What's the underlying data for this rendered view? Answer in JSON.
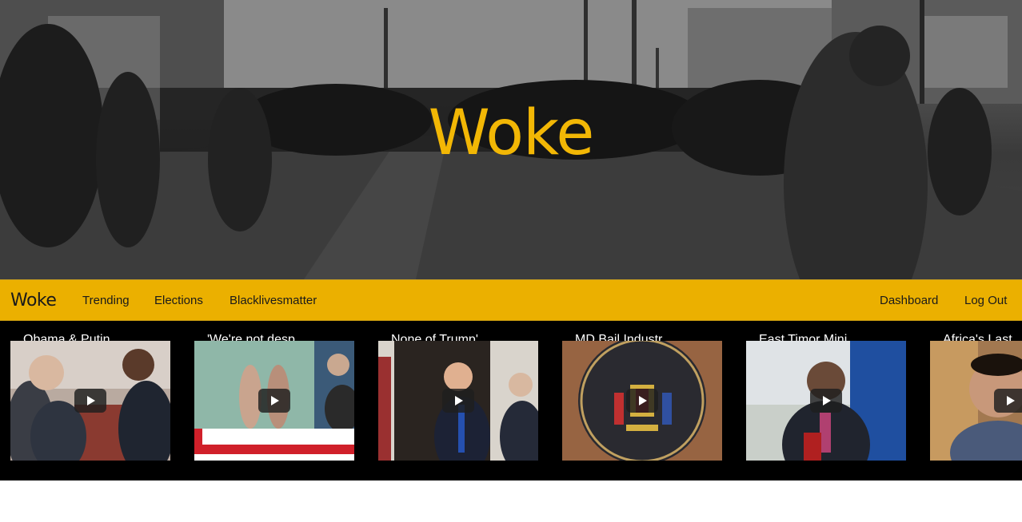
{
  "hero": {
    "title": "Woke",
    "background_icon": "street-protest-photo"
  },
  "navbar": {
    "brand": "Woke",
    "left_links": [
      "Trending",
      "Elections",
      "Blacklivesmatter"
    ],
    "right_links": [
      "Dashboard",
      "Log Out"
    ]
  },
  "videos": [
    {
      "title": "Obama & Putin ...",
      "thumb_icon": "leaders-meeting-thumbnail"
    },
    {
      "title": "'We're not desp...",
      "thumb_icon": "news-broadcast-thumbnail"
    },
    {
      "title": "None of Trump'...",
      "thumb_icon": "press-doorway-thumbnail"
    },
    {
      "title": "MD Bail Industr...",
      "thumb_icon": "judiciary-seal-thumbnail"
    },
    {
      "title": "East Timor Mini...",
      "thumb_icon": "interview-thumbnail"
    },
    {
      "title": "Africa's Last",
      "thumb_icon": "portrait-thumbnail"
    }
  ],
  "colors": {
    "brand_yellow": "#ebb000",
    "hero_title": "#f2b705",
    "strip_bg": "#000000"
  }
}
